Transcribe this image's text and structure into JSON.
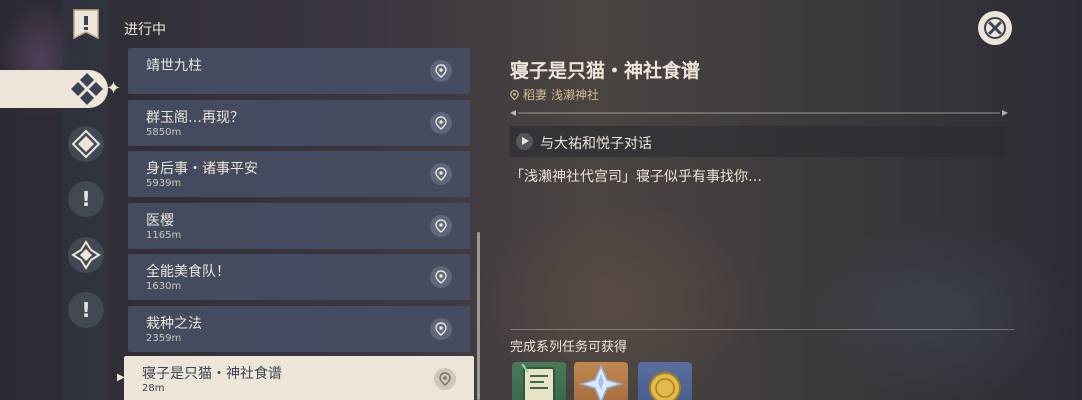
{
  "header": {
    "section_title": "进行中"
  },
  "nav": {
    "tabs": [
      {
        "icon": "archon-quest-icon"
      },
      {
        "icon": "all-quests-icon",
        "active": true
      },
      {
        "icon": "world-quest-icon"
      },
      {
        "icon": "story-quest-icon"
      },
      {
        "icon": "commission-icon"
      },
      {
        "icon": "exclamation-icon"
      }
    ]
  },
  "quests": [
    {
      "name": "靖世九柱",
      "distance": ""
    },
    {
      "name": "群玉阁…再现？",
      "distance": "5850m"
    },
    {
      "name": "身后事・诸事平安",
      "distance": "5939m"
    },
    {
      "name": "医樱",
      "distance": "1165m"
    },
    {
      "name": "全能美食队！",
      "distance": "1630m"
    },
    {
      "name": "栽种之法",
      "distance": "2359m"
    },
    {
      "name": "寝子是只猫・神社食谱",
      "distance": "28m",
      "selected": true
    }
  ],
  "detail": {
    "title": "寝子是只猫・神社食谱",
    "region": "稻妻",
    "location": "浅濑神社",
    "objective": "与大祐和悦子对话",
    "description": "「浅濑神社代宫司」寝子似乎有事找你…",
    "rewards_title": "完成系列任务可获得",
    "rewards": [
      {
        "icon": "talent-book-icon"
      },
      {
        "icon": "primogem-icon"
      },
      {
        "icon": "mora-icon"
      }
    ]
  },
  "colors": {
    "text": "#ece5d8",
    "location_gold": "#d3bc8e",
    "list_item": "#465066",
    "selected_item": "#ece5d8"
  }
}
